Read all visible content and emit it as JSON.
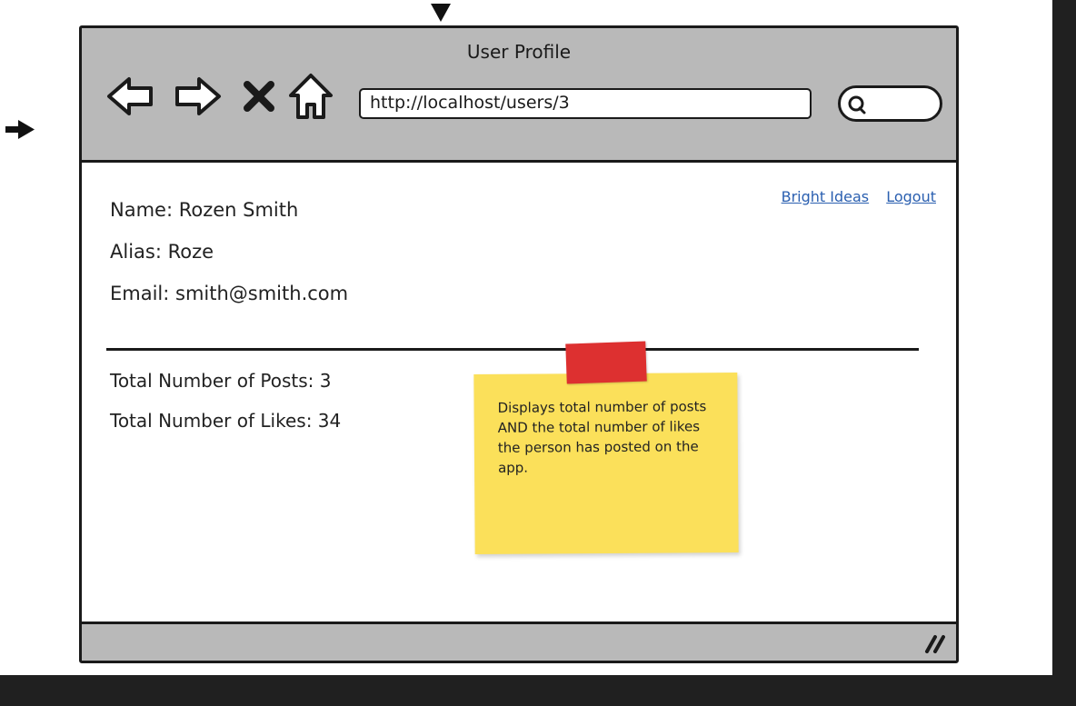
{
  "window": {
    "title": "User Profile"
  },
  "browser": {
    "address": "http://localhost/users/3"
  },
  "header_links": {
    "bright_ideas": "Bright Ideas",
    "logout": "Logout"
  },
  "profile": {
    "name": "Name: Rozen Smith",
    "alias": "Alias: Roze",
    "email": "Email: smith@smith.com"
  },
  "stats": {
    "posts_label": "Total Number of Posts:",
    "posts_value": "3",
    "likes_label": "Total Number of Likes:",
    "likes_value": "34"
  },
  "sticky_note": {
    "text": "Displays total number of posts AND the total number of likes the person has posted on the app."
  },
  "icons": [
    "arrow-left-icon",
    "arrow-right-icon",
    "close-icon",
    "home-icon",
    "search-icon",
    "resize-grip-icon",
    "pointer-down-icon",
    "pointer-right-icon"
  ],
  "colors": {
    "chrome": "#b9b9b9",
    "note": "#fbe05a",
    "tape": "#dd3030",
    "link": "#2a5fb0"
  }
}
